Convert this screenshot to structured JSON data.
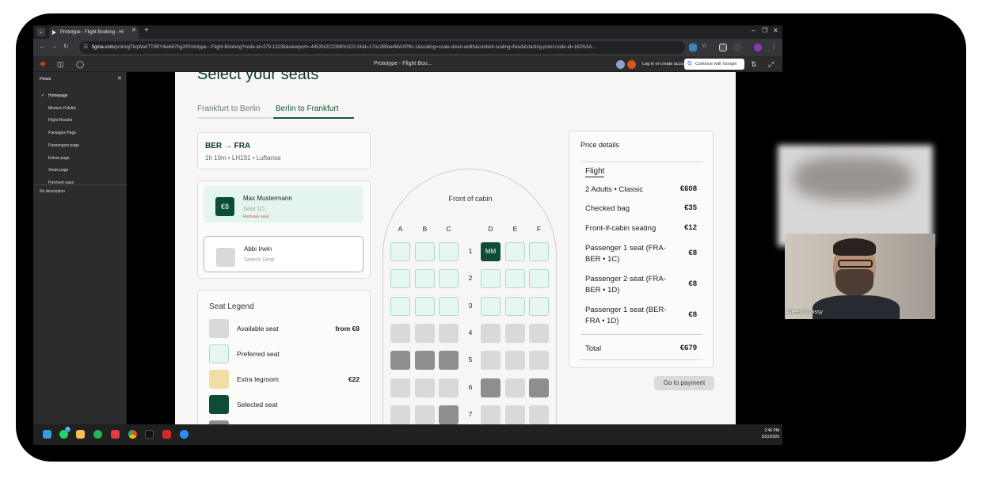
{
  "browser": {
    "tab_title": "Prototype - Flight Booking - Hi",
    "new_tab": "+",
    "url_domain": "figma.com",
    "url_rest": "/proto/gTlrqWa0TT8RY4ie667hg2/Prototype---Flight-Booking?node-id=279-13238&viewport=-4453%2C2388%2C0.24&t=17Ac2Bfoe4MAXP9c-1&scaling=scale-down-width&content-scaling=fixed&starting-point-node-id=163%3A..."
  },
  "figma": {
    "title": "Prototype - Flight Boo...",
    "login": "Log in or create account",
    "google_button": "Continue with Google"
  },
  "sidebar": {
    "header": "Flows",
    "items": [
      "Homepage",
      "Medium Fidelity",
      "Flight Results",
      "Packages Page",
      "Passengers page",
      "Extras page",
      "Seats page",
      "Payment page"
    ],
    "description": "No description"
  },
  "page": {
    "title": "Select your seats",
    "tabs": [
      "Frankfurt to Berlin",
      "Berlin to Frankfurt"
    ],
    "active_tab_index": 1,
    "flight": {
      "route": "BER → FRA",
      "meta": "1h  10m  •  LH191  •  Luftansa"
    },
    "passengers": [
      {
        "badge": "€8",
        "name": "Max Mustermann",
        "seat": "Seat 1D",
        "remove": "Remove seat",
        "selected": true
      },
      {
        "badge": "",
        "name": "Abbi Irwin",
        "seat": "Select Seat",
        "selected": false
      }
    ],
    "legend": {
      "title": "Seat Legend",
      "items": [
        {
          "label": "Available seat",
          "price": "from €8",
          "color": "#d9d9d9"
        },
        {
          "label": "Preferred seat",
          "price": "",
          "color": "#e6f7ef"
        },
        {
          "label": "Extra legroom",
          "price": "€22",
          "color": "#efdfa5"
        },
        {
          "label": "Selected seat",
          "price": "",
          "color": "#0e4d35"
        }
      ]
    },
    "cabin": {
      "front_label": "Front of cabin",
      "columns": [
        "A",
        "B",
        "C",
        "D",
        "E",
        "F"
      ],
      "rows": [
        "1",
        "2",
        "3",
        "4",
        "5",
        "6",
        "7"
      ],
      "selected_label": "MM"
    },
    "price": {
      "title": "Price details",
      "section": "Flight",
      "lines": [
        {
          "label": "2 Adults • Classic",
          "value": "€608"
        },
        {
          "label": "Checked bag",
          "value": "€35"
        },
        {
          "label": "Front-if-cabin seating",
          "value": "€12"
        },
        {
          "label": "Passenger 1 seat (FRA-BER • 1C)",
          "value": "€8"
        },
        {
          "label": "Passenger 2 seat (FRA-BER • 1D)",
          "value": "€8"
        },
        {
          "label": "Passenger 1 seat (BER-FRA • 1D)",
          "value": "€8"
        }
      ],
      "total_label": "Total",
      "total_value": "€679"
    },
    "go_button": "Go to payment"
  },
  "taskbar": {
    "time": "2:46 PM",
    "date": "5/22/2026",
    "whatsapp_badge": "5"
  },
  "video": {
    "participant_name": "Adeeb Graissy"
  },
  "colors": {
    "brand_green": "#0e4d35",
    "preferred": "#e6f7ef",
    "preferred_border": "#a8dcc3",
    "available": "#d9d9d9",
    "occupied": "#8e8e8e"
  }
}
